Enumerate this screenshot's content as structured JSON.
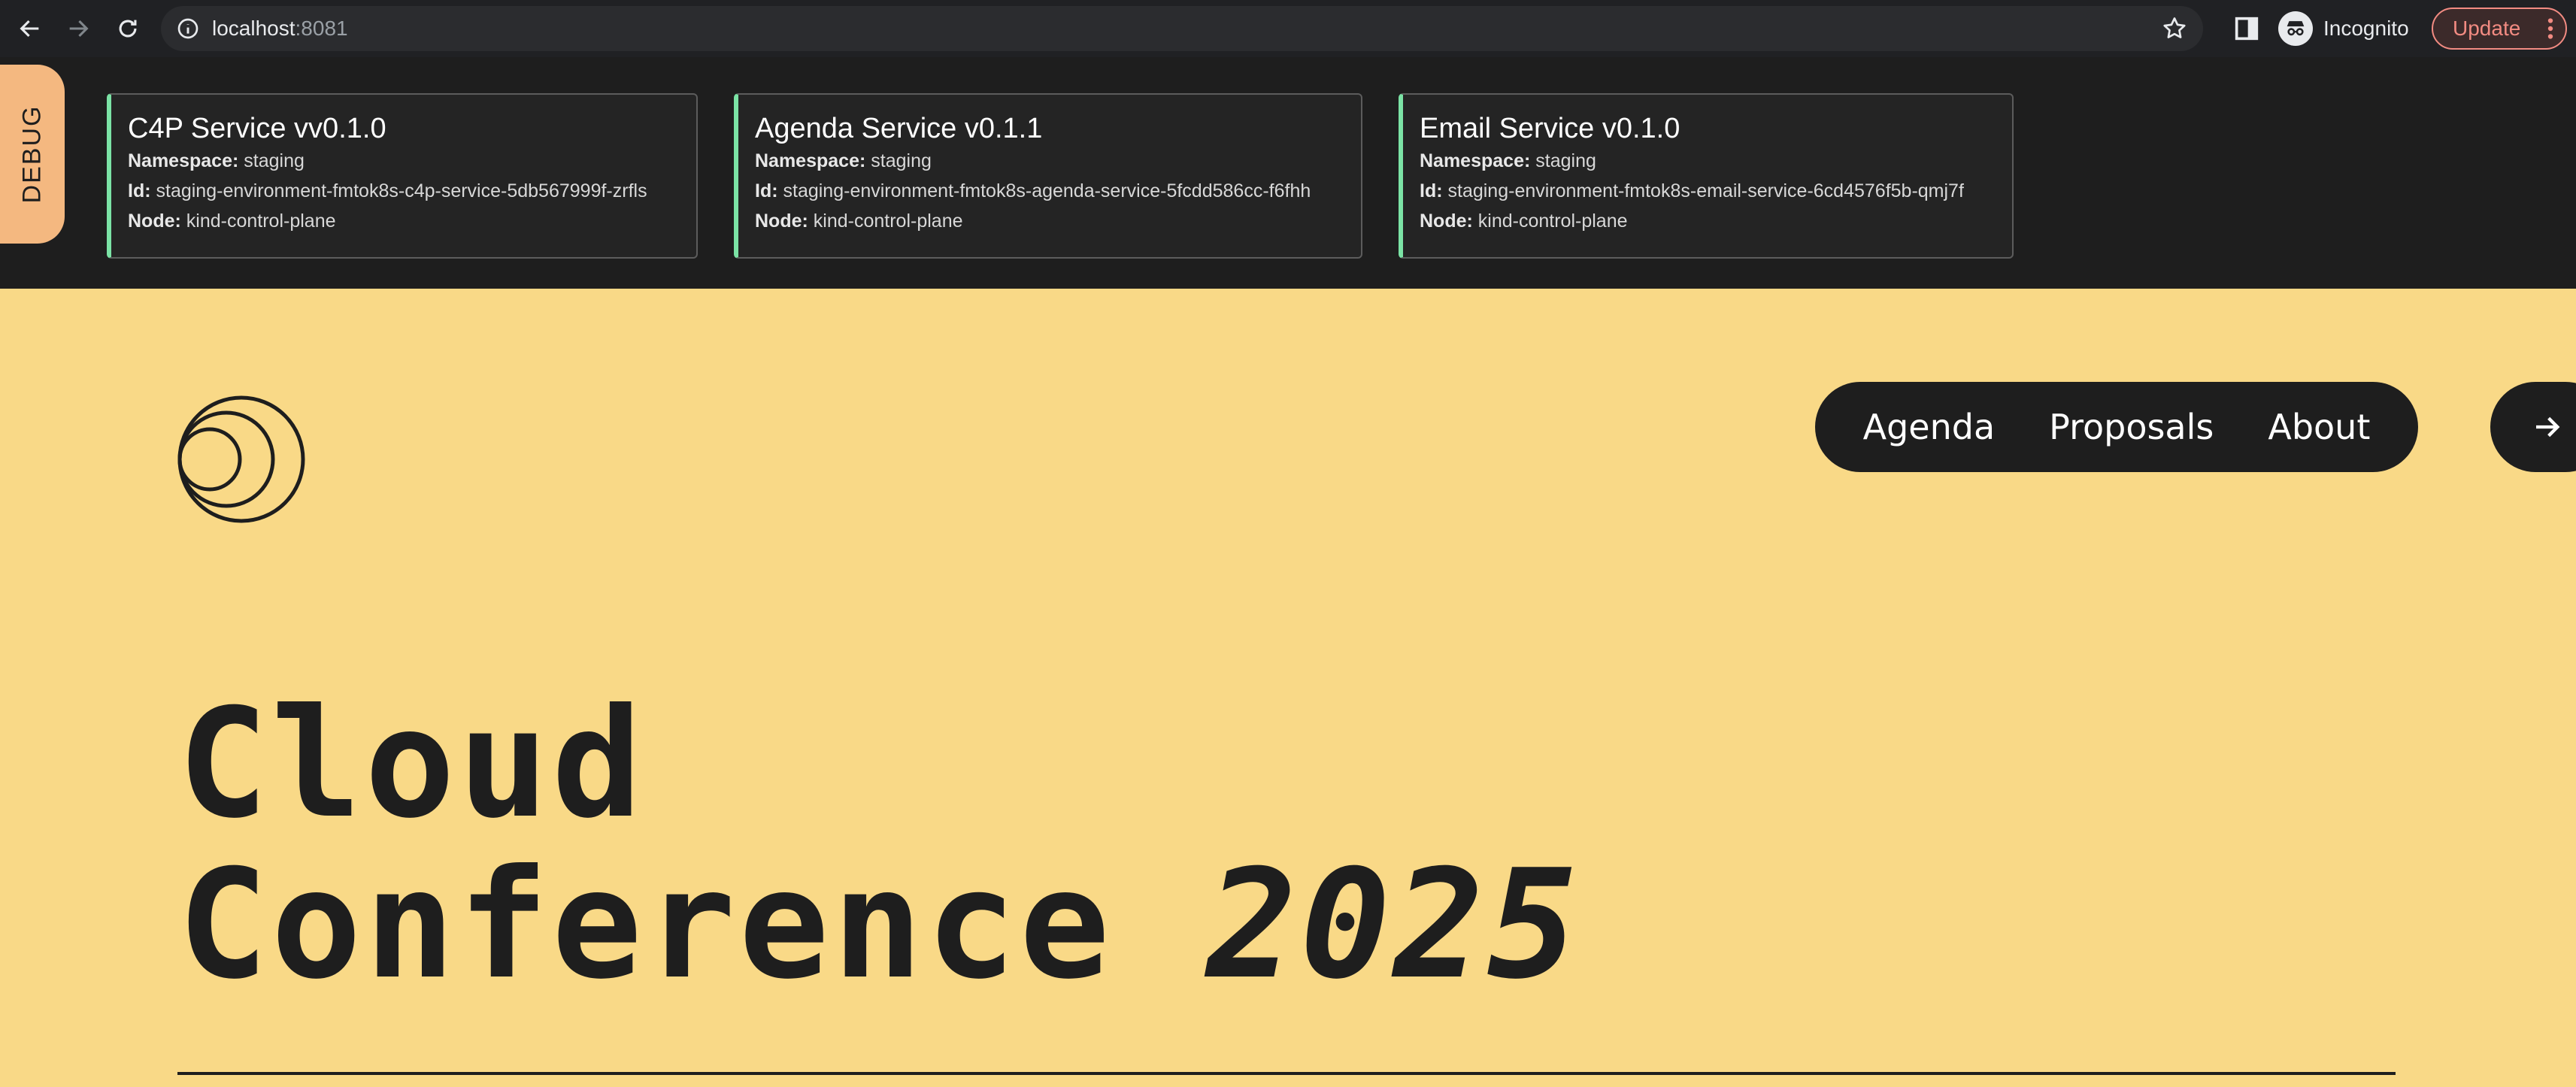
{
  "browser": {
    "url_host": "localhost",
    "url_port": ":8081",
    "profile_label": "Incognito",
    "update_label": "Update"
  },
  "debug": {
    "tab_label": "DEBUG",
    "field_labels": {
      "namespace": "Namespace:",
      "id": "Id:",
      "node": "Node:"
    },
    "accent_color": "#7be3a5",
    "services": [
      {
        "title": "C4P Service vv0.1.0",
        "namespace": "staging",
        "id": "staging-environment-fmtok8s-c4p-service-5db567999f-zrfls",
        "node": "kind-control-plane"
      },
      {
        "title": "Agenda Service v0.1.1",
        "namespace": "staging",
        "id": "staging-environment-fmtok8s-agenda-service-5fcdd586cc-f6fhh",
        "node": "kind-control-plane"
      },
      {
        "title": "Email Service v0.1.0",
        "namespace": "staging",
        "id": "staging-environment-fmtok8s-email-service-6cd4576f5b-qmj7f",
        "node": "kind-control-plane"
      }
    ]
  },
  "site": {
    "nav": [
      {
        "label": "Agenda"
      },
      {
        "label": "Proposals"
      },
      {
        "label": "About"
      }
    ],
    "hero_line1": "Cloud",
    "hero_line2": "Conference ",
    "hero_year": "2025",
    "background_color": "#f9d987",
    "dark_color": "#1e1e1e"
  }
}
